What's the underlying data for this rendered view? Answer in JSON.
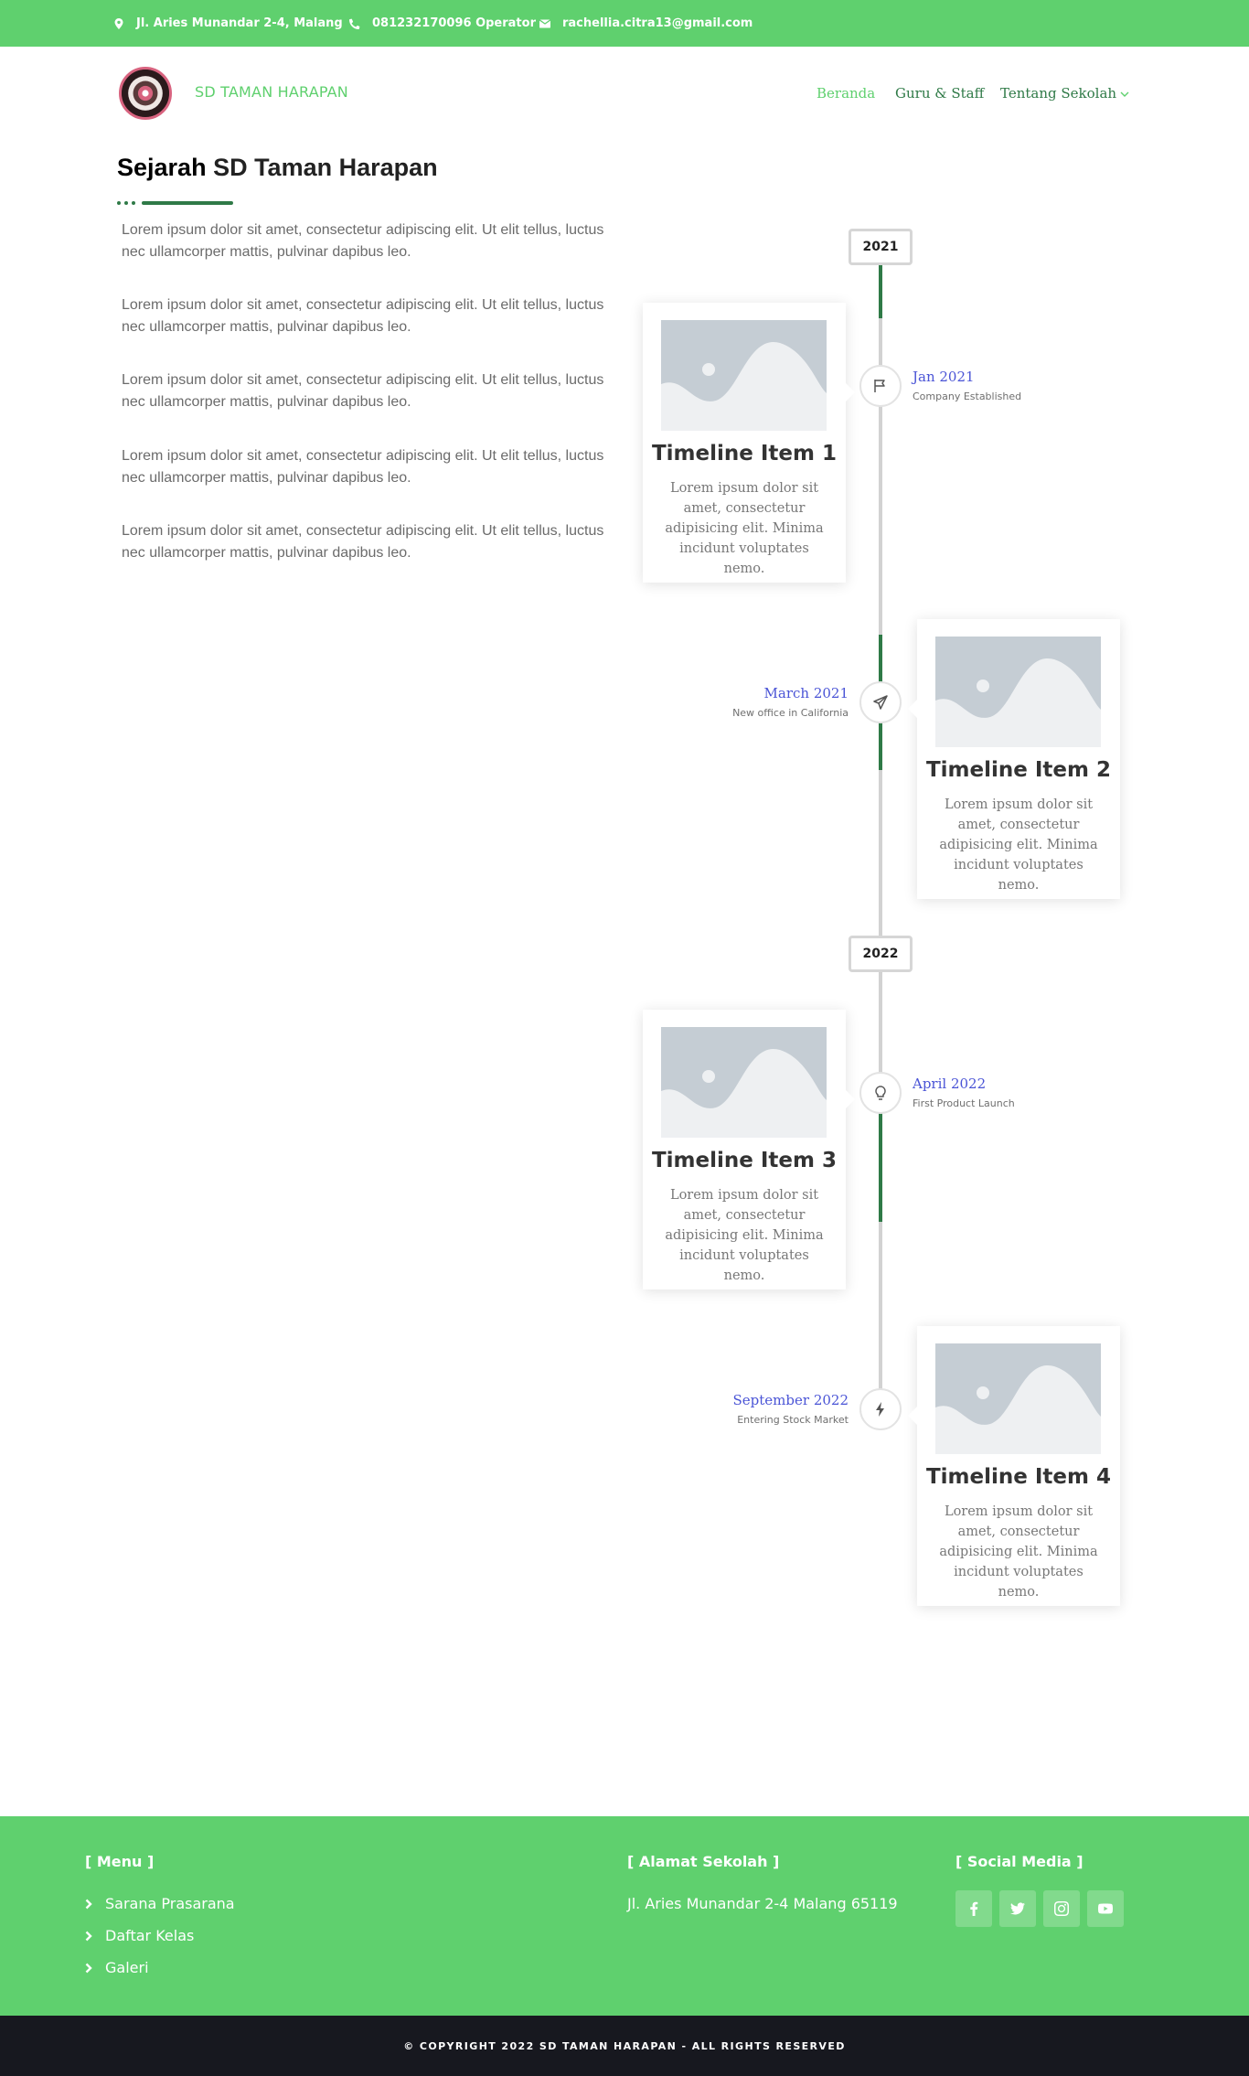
{
  "topbar": {
    "address": "Jl. Aries Munandar 2-4, Malang",
    "phone": "081232170096 Operator",
    "email": "rachellia.citra13@gmail.com"
  },
  "header": {
    "brand": "SD TAMAN HARAPAN",
    "nav": [
      {
        "label": "Beranda",
        "active": true
      },
      {
        "label": "Guru & Staff",
        "active": false
      },
      {
        "label": "Tentang Sekolah",
        "active": false,
        "has_dropdown": true
      }
    ]
  },
  "page": {
    "title_bold": "Sejarah",
    "title_rest": " SD Taman Harapan",
    "paragraphs": [
      "Lorem ipsum dolor sit amet, consectetur adipiscing elit. Ut elit tellus, luctus nec ullamcorper mattis, pulvinar dapibus leo.",
      "Lorem ipsum dolor sit amet, consectetur adipiscing elit. Ut elit tellus, luctus nec ullamcorper mattis, pulvinar dapibus leo.",
      "Lorem ipsum dolor sit amet, consectetur adipiscing elit. Ut elit tellus, luctus nec ullamcorper mattis, pulvinar dapibus leo.",
      "Lorem ipsum dolor sit amet, consectetur adipiscing elit. Ut elit tellus, luctus nec ullamcorper mattis, pulvinar dapibus leo.",
      "Lorem ipsum dolor sit amet, consectetur adipiscing elit. Ut elit tellus, luctus nec ullamcorper mattis, pulvinar dapibus leo."
    ]
  },
  "timeline": {
    "years": [
      "2021",
      "2022"
    ],
    "items": [
      {
        "title": "Timeline Item 1",
        "text": "Lorem ipsum dolor sit amet, consectetur adipisicing elit. Minima incidunt voluptates nemo.",
        "date": "Jan 2021",
        "subtitle": "Company Established",
        "icon": "flag-icon"
      },
      {
        "title": "Timeline Item 2",
        "text": "Lorem ipsum dolor sit amet, consectetur adipisicing elit. Minima incidunt voluptates nemo.",
        "date": "March 2021",
        "subtitle": "New office in California",
        "icon": "paper-plane-icon"
      },
      {
        "title": "Timeline Item 3",
        "text": "Lorem ipsum dolor sit amet, consectetur adipisicing elit. Minima incidunt voluptates nemo.",
        "date": "April 2022",
        "subtitle": "First Product Launch",
        "icon": "lightbulb-icon"
      },
      {
        "title": "Timeline Item 4",
        "text": "Lorem ipsum dolor sit amet, consectetur adipisicing elit. Minima incidunt voluptates nemo.",
        "date": "September 2022",
        "subtitle": "Entering Stock Market",
        "icon": "bolt-icon"
      }
    ]
  },
  "footer": {
    "menu_heading": "[ Menu ]",
    "menu_items": [
      "Sarana Prasarana",
      "Daftar Kelas",
      "Galeri"
    ],
    "address_heading": "[ Alamat Sekolah ]",
    "address": "Jl. Aries Munandar 2-4 Malang 65119",
    "social_heading": "[ Social Media ]",
    "social_icons": [
      "facebook-icon",
      "twitter-icon",
      "instagram-icon",
      "youtube-icon"
    ]
  },
  "copyright": "© COPYRIGHT 2022 SD TAMAN HARAPAN - ALL RIGHTS RESERVED",
  "colors": {
    "primary_green": "#5fd06e",
    "dark_green": "#2f7a47",
    "timeline_date": "#4a54d6",
    "copyright_bg": "#17181f"
  }
}
